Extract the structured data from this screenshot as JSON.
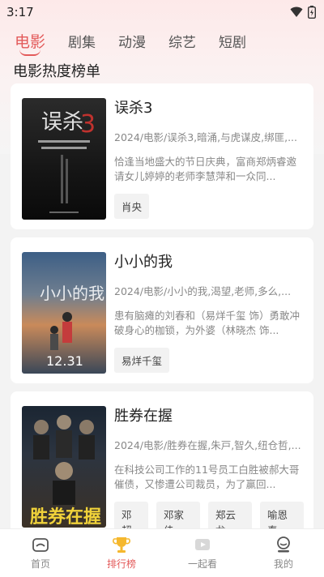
{
  "status": {
    "time": "3:17"
  },
  "tabs": [
    {
      "label": "电影"
    },
    {
      "label": "剧集"
    },
    {
      "label": "动漫"
    },
    {
      "label": "综艺"
    },
    {
      "label": "短剧"
    }
  ],
  "section_title": "电影热度榜单",
  "movies": [
    {
      "title": "误杀3",
      "meta": "2024/电影/误杀3,暗涌,与虎谋皮,绑匪,...",
      "desc": "恰逢当地盛大的节日庆典，富商郑炳睿邀请女儿婷婷的老师李慧萍和一众同...",
      "actors": [
        "肖央"
      ],
      "poster_colors": [
        "#2a2a2a",
        "#0d0d0d"
      ]
    },
    {
      "title": "小小的我",
      "meta": "2024/电影/小小的我,渴望,老师,多么,...",
      "desc": "患有脑瘫的刘春和（易烊千玺 饰）勇敢冲破身心的枷锁，为外婆（林晓杰 饰...",
      "actors": [
        "易烊千玺"
      ],
      "poster_colors": [
        "#4a6d93",
        "#c87a4a"
      ]
    },
    {
      "title": "胜券在握",
      "meta": "2024/电影/胜券在握,朱戸,智久,纽仓哲,...",
      "desc": "在科技公司工作的11号员工白胜被郝大哥催债，又惨遭公司裁员，为了赢回...",
      "actors": [
        "邓超",
        "邓家佳",
        "郑云龙",
        "喻恩泰"
      ],
      "poster_colors": [
        "#1e2a38",
        "#3a3024"
      ]
    }
  ],
  "nav": [
    {
      "label": "首页",
      "icon": "home-icon"
    },
    {
      "label": "排行榜",
      "icon": "trophy-icon"
    },
    {
      "label": "一起看",
      "icon": "video-icon"
    },
    {
      "label": "我的",
      "icon": "profile-icon"
    }
  ],
  "colors": {
    "accent": "#e35a5a",
    "page_bg": "#f3f3f3"
  }
}
